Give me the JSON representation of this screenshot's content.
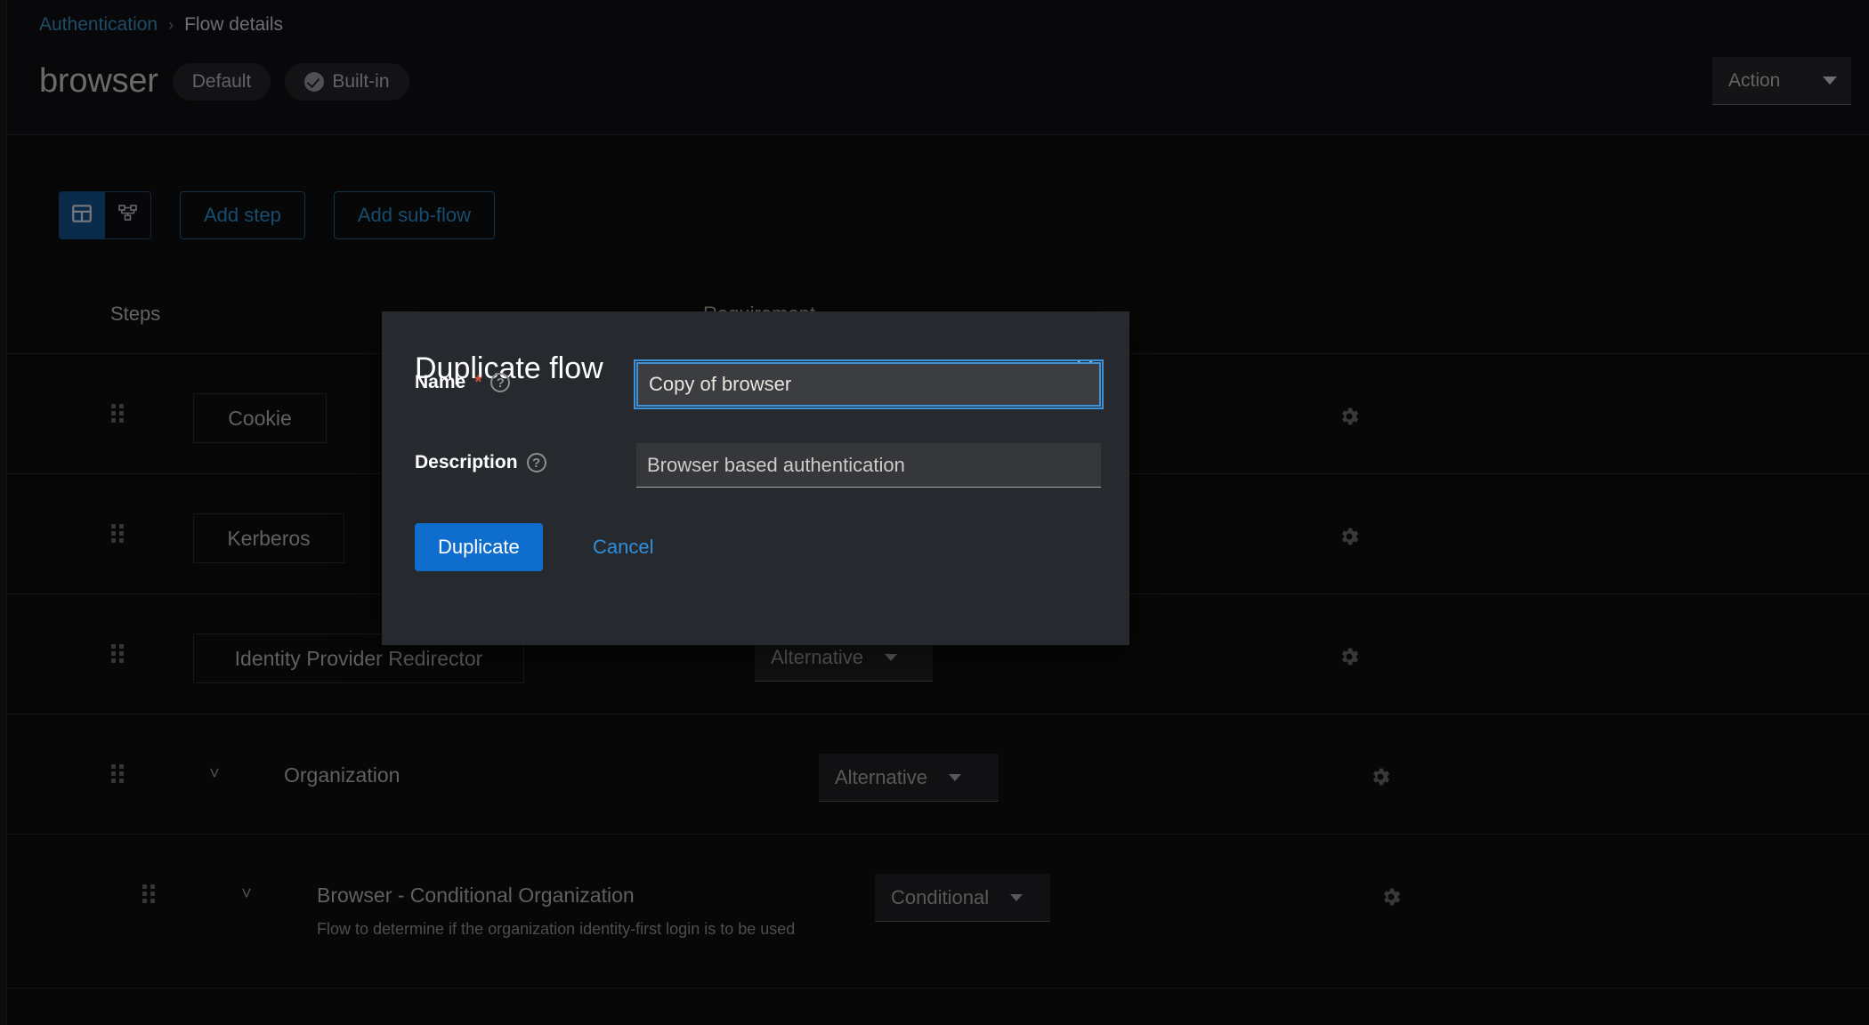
{
  "breadcrumb": {
    "root": "Authentication",
    "separator": "›",
    "current": "Flow details"
  },
  "header": {
    "title": "browser",
    "badges": [
      {
        "label": "Default",
        "icon": ""
      },
      {
        "label": "Built-in",
        "icon": "check-circle-icon"
      }
    ],
    "action_label": "Action"
  },
  "toolbar": {
    "view_table_icon": "table-view-icon",
    "view_diagram_icon": "diagram-view-icon",
    "add_step_label": "Add step",
    "add_subflow_label": "Add sub-flow"
  },
  "table": {
    "columns": {
      "steps": "Steps",
      "requirement": "Requirement"
    },
    "rows": [
      {
        "name": "Cookie",
        "style": "boxed",
        "indent": 0,
        "requirement": "",
        "description": "",
        "has_chevron": false,
        "has_gear": true
      },
      {
        "name": "Kerberos",
        "style": "boxed",
        "indent": 0,
        "requirement": "",
        "description": "",
        "has_chevron": false,
        "has_gear": true
      },
      {
        "name": "Identity Provider Redirector",
        "style": "boxed",
        "indent": 0,
        "requirement": "Alternative",
        "description": "",
        "has_chevron": false,
        "has_gear": true
      },
      {
        "name": "Organization",
        "style": "plain",
        "indent": 1,
        "requirement": "Alternative",
        "description": "",
        "has_chevron": true,
        "has_gear": true
      },
      {
        "name": "Browser - Conditional Organization",
        "style": "plain",
        "indent": 2,
        "requirement": "Conditional",
        "description": "Flow to determine if the organization identity-first login is to be used",
        "has_chevron": true,
        "has_gear": true
      }
    ]
  },
  "modal": {
    "title": "Duplicate flow",
    "close_icon": "close-icon",
    "name_label": "Name",
    "name_required_mark": "*",
    "name_help_icon": "help-icon",
    "name_value": "Copy of browser",
    "description_label": "Description",
    "description_help_icon": "help-icon",
    "description_value": "Browser based authentication",
    "submit_label": "Duplicate",
    "cancel_label": "Cancel"
  },
  "colors": {
    "accent_blue": "#0f6ecd",
    "focus_blue": "#3e92d8",
    "link_blue": "#2f8fde",
    "required_red": "#c9513c",
    "page_bg": "#0a0a0b",
    "modal_bg": "#26292d"
  }
}
